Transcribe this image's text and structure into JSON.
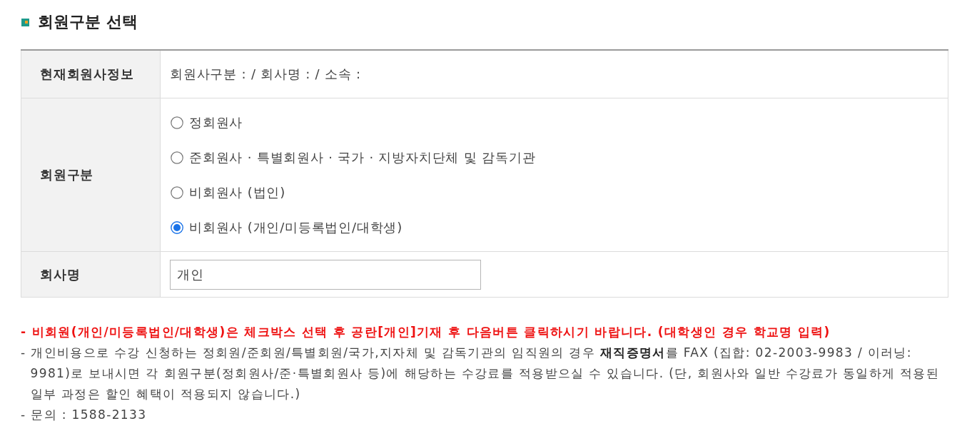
{
  "section": {
    "title": "회원구분 선택"
  },
  "form": {
    "rows": [
      {
        "kind": "text",
        "label": "현재회원사정보",
        "value": "회원사구분 : / 회사명 : / 소속 :"
      },
      {
        "kind": "radio",
        "label": "회원구분",
        "options": [
          {
            "label": "정회원사",
            "selected": false
          },
          {
            "label": "준회원사 · 특별회원사 · 국가 · 지방자치단체 및 감독기관",
            "selected": false
          },
          {
            "label": "비회원사 (법인)",
            "selected": false
          },
          {
            "label": "비회원사 (개인/미등록법인/대학생)",
            "selected": true
          }
        ]
      },
      {
        "kind": "input",
        "label": "회사명",
        "value": "개인"
      }
    ]
  },
  "notes": [
    {
      "kind": "alert",
      "text": "- 비회원(개인/미등록법인/대학생)은 체크박스 선택 후 공란[개인]기재 후 다음버튼 클릭하시기 바랍니다. (대학생인 경우 학교명 입력)"
    },
    {
      "kind": "plain",
      "text": "- 개인비용으로 수강 신청하는 정회원/준회원/특별회원/국가,지자체 및 감독기관의 임직원의 경우 **재직증명서**를 FAX (집합: 02-2003-9983 / 이러닝: 9981)로 보내시면 각 회원구분(정회원사/준·특별회원사 등)에 해당하는 수강료를 적용받으실 수 있습니다. (단, 회원사와 일반 수강료가 동일하게 적용된 일부 과정은 할인 혜택이 적용되지 않습니다.)"
    },
    {
      "kind": "plain",
      "text": "- 문의 : 1588-2133"
    }
  ]
}
